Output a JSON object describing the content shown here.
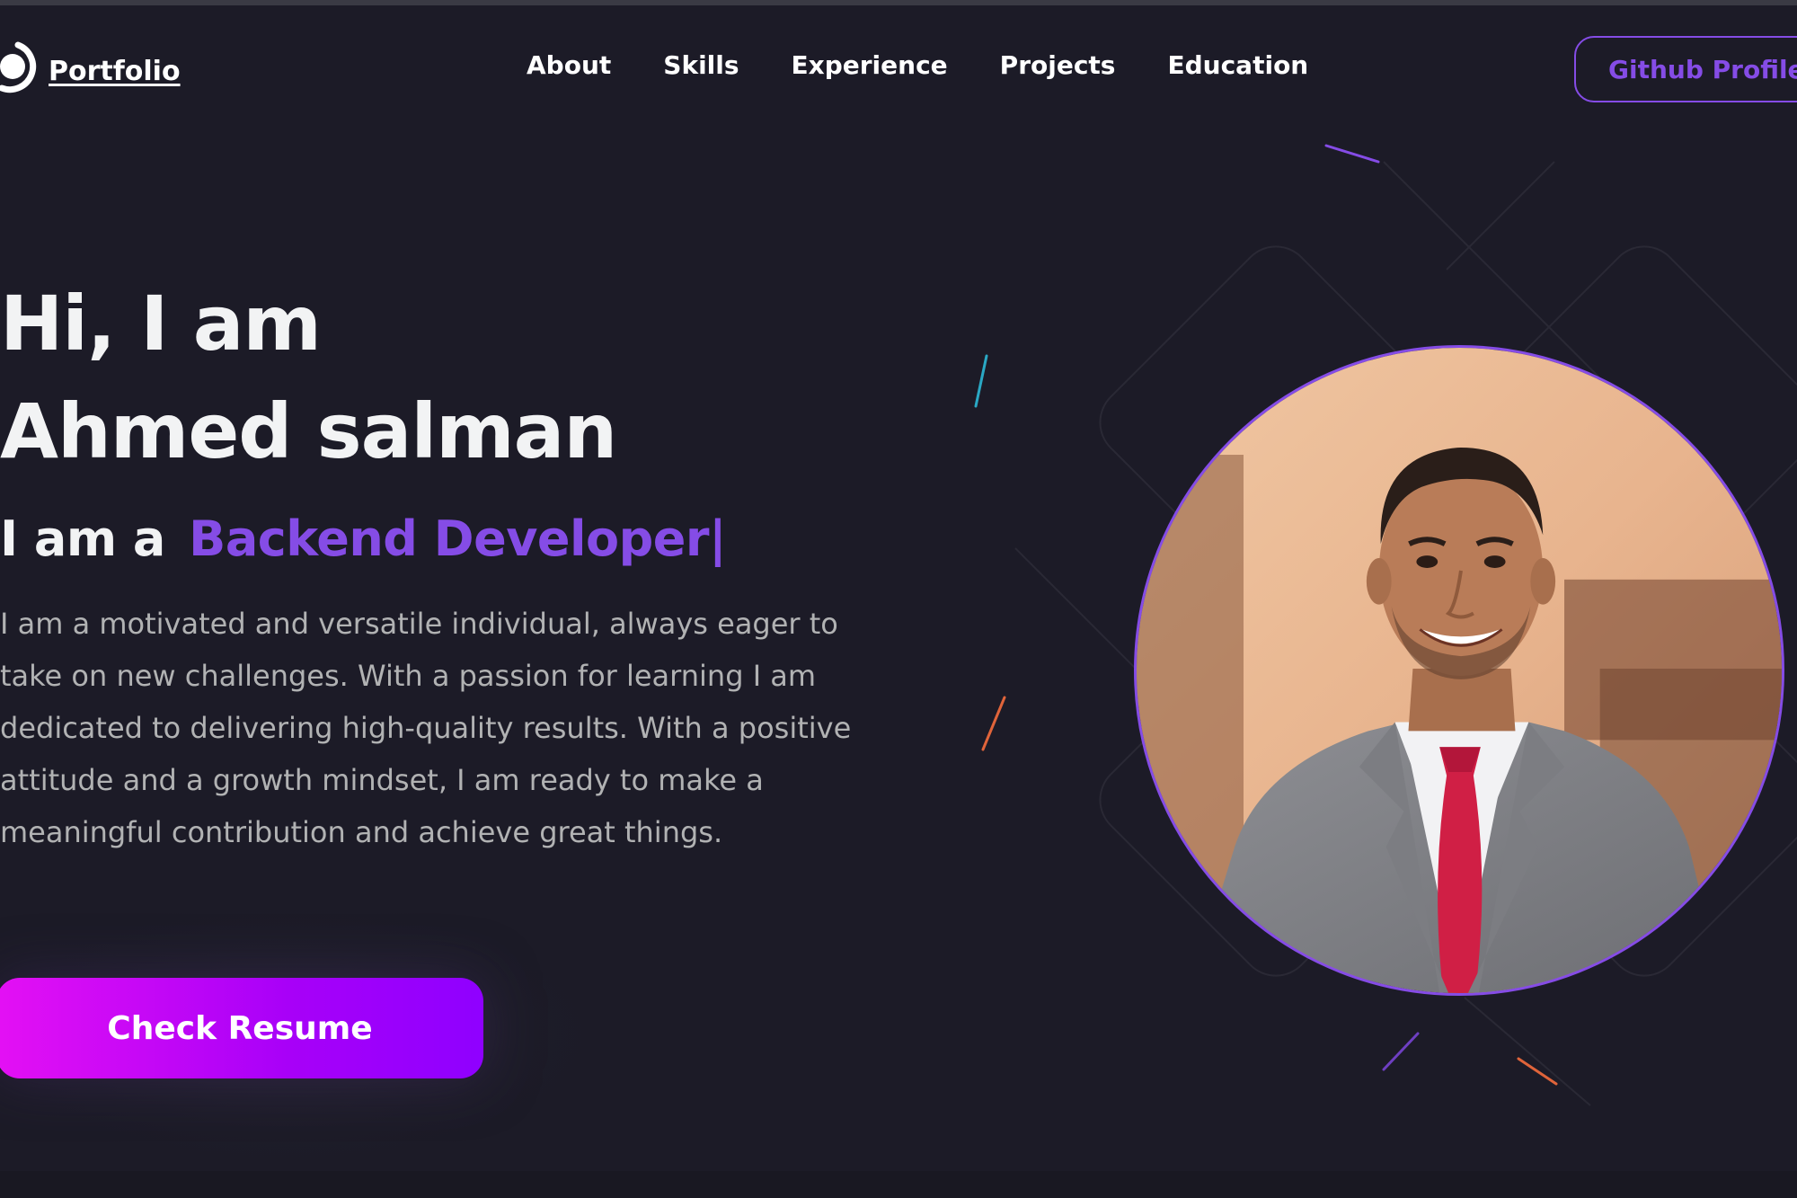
{
  "brand": {
    "name": "Portfolio",
    "icon": "logo-icon"
  },
  "nav": {
    "items": [
      {
        "label": "About"
      },
      {
        "label": "Skills"
      },
      {
        "label": "Experience"
      },
      {
        "label": "Projects"
      },
      {
        "label": "Education"
      }
    ],
    "github_label": "Github Profile"
  },
  "hero": {
    "title_line1": "Hi, I am",
    "title_line2": "Ahmed salman",
    "role_prefix": "I am a",
    "role_text": "Backend Developer",
    "role_cursor": "|",
    "bio": "I am a motivated and versatile individual, always eager to take on new challenges. With a passion for learning I am dedicated to delivering high-quality results. With a positive attitude and a growth mindset, I am ready to make a meaningful contribution and achieve great things.",
    "cta_label": "Check Resume"
  },
  "profile": {
    "icon": "profile-photo"
  },
  "colors": {
    "background": "#1c1b27",
    "accent": "#854ce6",
    "text_primary": "#f2f3f4",
    "text_secondary": "#b1b2b3",
    "cta_gradient_start": "#e410f4",
    "cta_gradient_end": "#8f00ff"
  }
}
